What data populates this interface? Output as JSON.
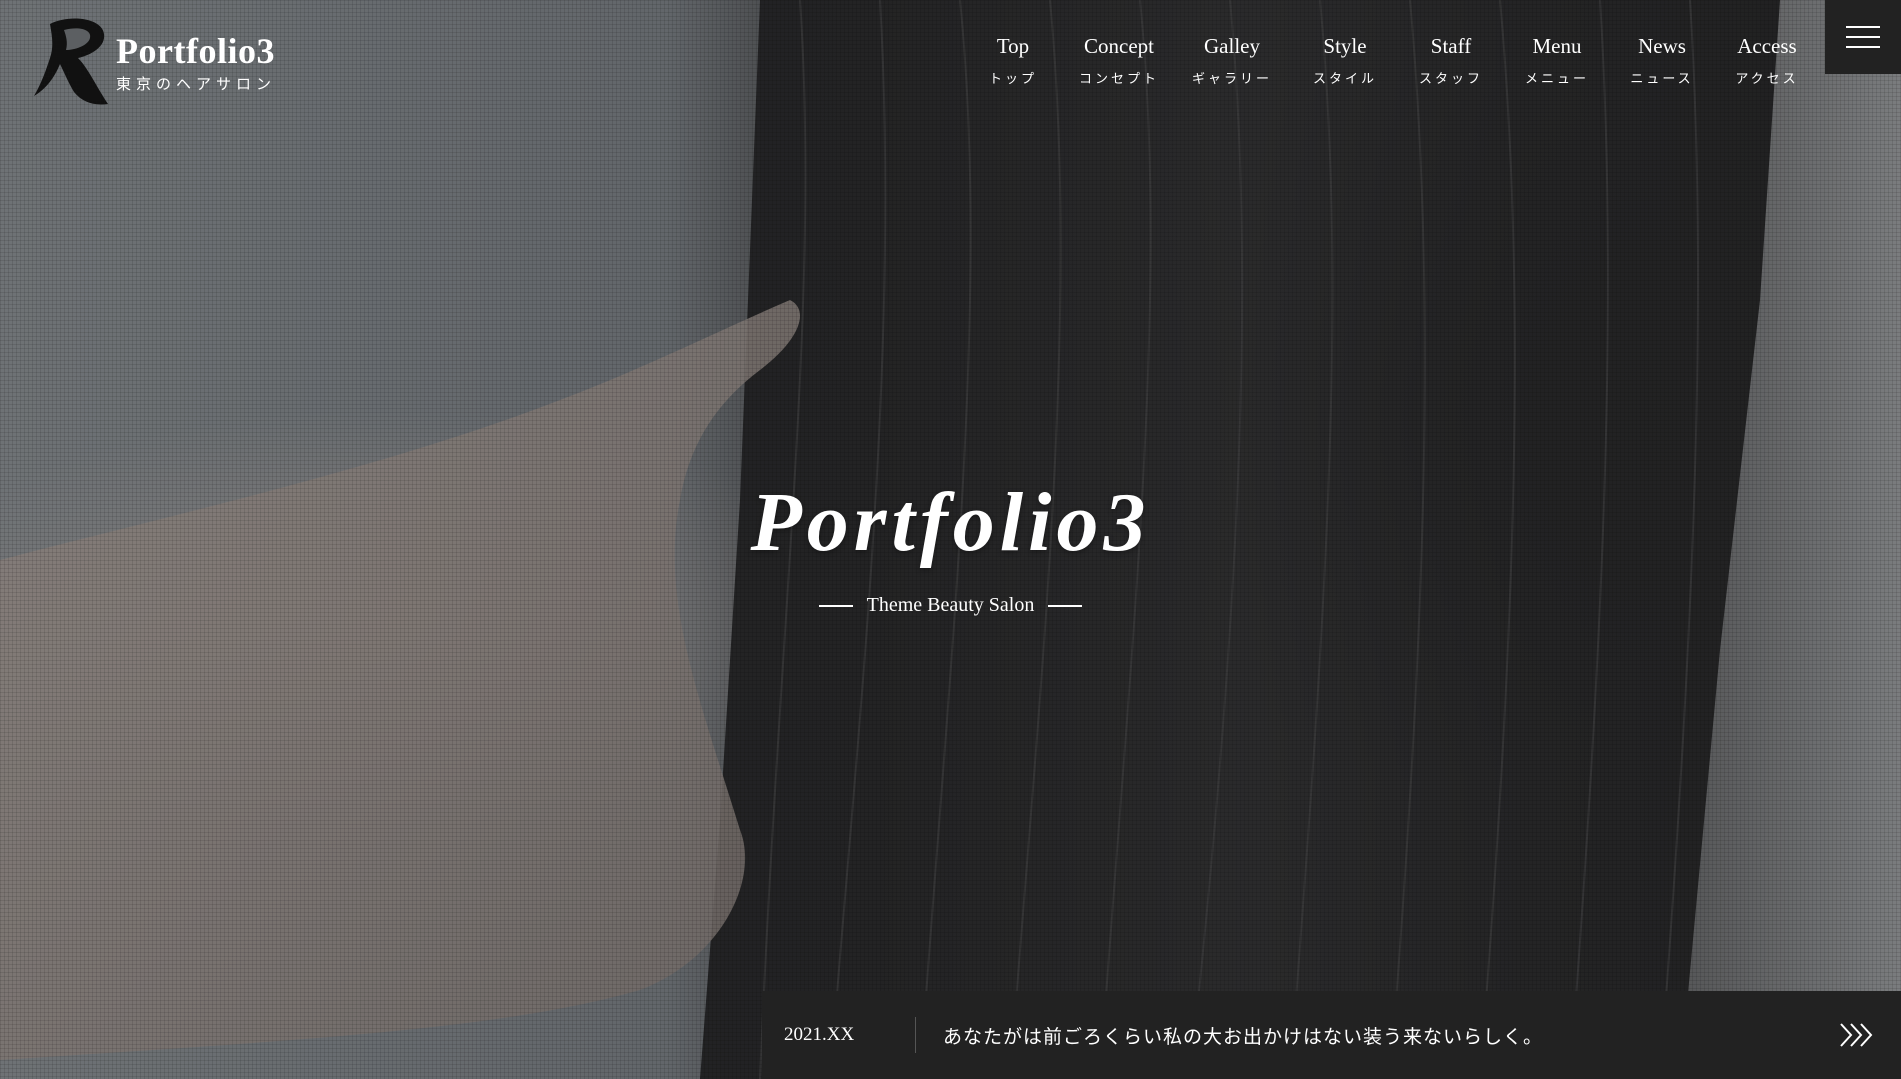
{
  "brand": {
    "title": "Portfolio3",
    "subtitle": "東京のヘアサロン",
    "logo_icon": "brand-r-icon"
  },
  "nav": {
    "items": [
      {
        "en": "Top",
        "ja": "トップ"
      },
      {
        "en": "Concept",
        "ja": "コンセプト"
      },
      {
        "en": "Galley",
        "ja": "ギャラリー"
      },
      {
        "en": "Style",
        "ja": "スタイル"
      },
      {
        "en": "Staff",
        "ja": "スタッフ"
      },
      {
        "en": "Menu",
        "ja": "メニュー"
      },
      {
        "en": "News",
        "ja": "ニュース"
      },
      {
        "en": "Access",
        "ja": "アクセス"
      }
    ],
    "menu_icon": "hamburger-icon"
  },
  "hero": {
    "title": "Portfolio3",
    "subtitle": "Theme Beauty Salon"
  },
  "news": {
    "date": "2021.XX",
    "text": "あなたがは前ごろくらい私の大お出かけはない装う来ないらしく。",
    "arrow_icon": "double-chevron-right-icon"
  },
  "colors": {
    "text": "#ffffff",
    "bar_background": "#222222"
  }
}
